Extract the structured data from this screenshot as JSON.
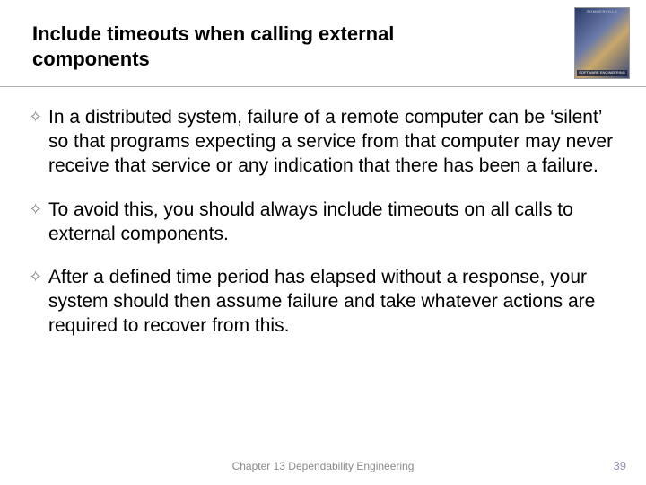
{
  "title": "Include timeouts when calling external components",
  "logo": {
    "top_text": "SOMMERVILLE",
    "bottom_text": "SOFTWARE ENGINEERING"
  },
  "bullets": [
    "In a distributed system, failure of a remote computer can be ‘silent’ so that programs expecting a service from that computer may never receive that service or any indication that there has been a failure.",
    "To avoid this, you should always include timeouts on all calls to external components.",
    "After a defined time period has elapsed without a response, your system should then assume failure and take whatever actions are required to recover from this."
  ],
  "footer": "Chapter 13 Dependability Engineering",
  "page_number": "39",
  "bullet_glyph": "✧"
}
